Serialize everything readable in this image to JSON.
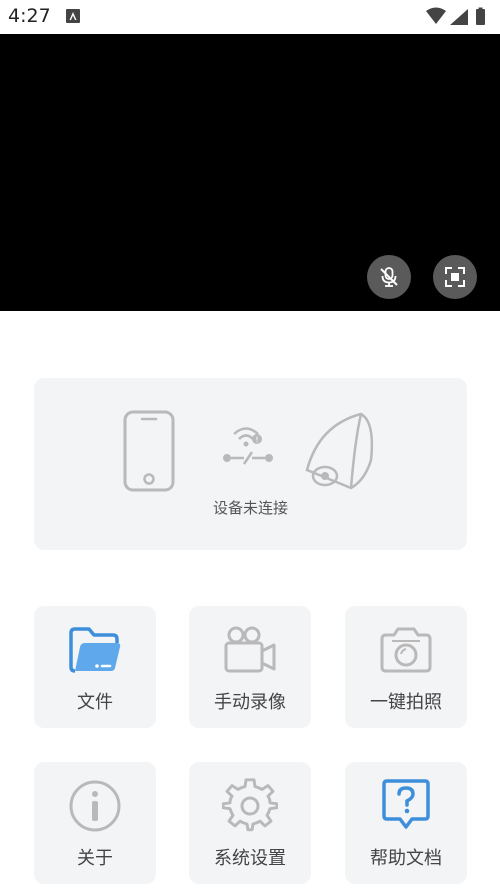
{
  "status_bar": {
    "time": "4:27"
  },
  "video": {
    "mute_icon": "mic-off-icon",
    "fullscreen_icon": "fullscreen-icon"
  },
  "connection": {
    "status_text": "设备未连接"
  },
  "menu": [
    {
      "label": "文件",
      "icon": "folder-icon",
      "accent": "#3d8fdc"
    },
    {
      "label": "手动录像",
      "icon": "video-camera-icon"
    },
    {
      "label": "一键拍照",
      "icon": "photo-camera-icon"
    },
    {
      "label": "关于",
      "icon": "info-icon"
    },
    {
      "label": "系统设置",
      "icon": "gear-icon"
    },
    {
      "label": "帮助文档",
      "icon": "help-icon",
      "accent": "#3d8fdc"
    }
  ]
}
